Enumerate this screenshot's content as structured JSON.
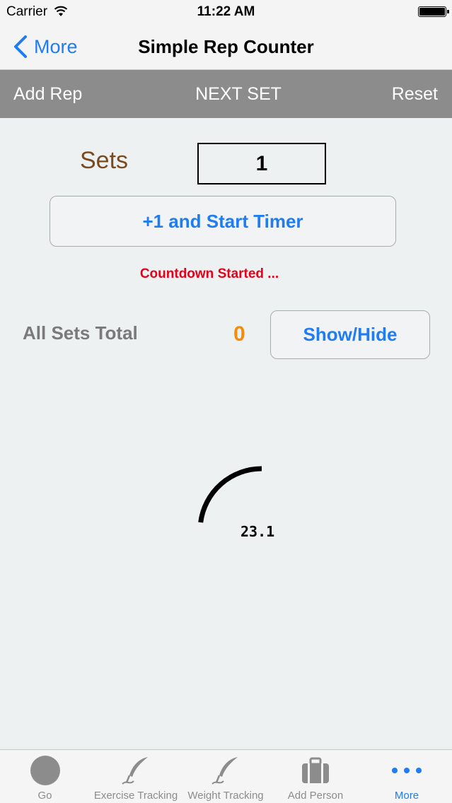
{
  "status_bar": {
    "carrier": "Carrier",
    "time": "11:22 AM"
  },
  "nav": {
    "back_label": "More",
    "title": "Simple Rep Counter"
  },
  "toolbar": {
    "add_rep": "Add Rep",
    "next_set": "NEXT SET",
    "reset": "Reset"
  },
  "sets": {
    "label": "Sets",
    "value": "1"
  },
  "start_timer_label": "+1 and Start Timer",
  "countdown_status": "Countdown Started ...",
  "totals": {
    "label": "All Sets Total",
    "value": "0",
    "toggle_label": "Show/Hide"
  },
  "timer": {
    "display": "23.1",
    "progress": 0.23
  },
  "tabs": [
    {
      "label": "Go",
      "icon": "circle-icon"
    },
    {
      "label": "Exercise Tracking",
      "icon": "quill-icon"
    },
    {
      "label": "Weight Tracking",
      "icon": "quill-icon"
    },
    {
      "label": "Add Person",
      "icon": "briefcase-icon"
    },
    {
      "label": "More",
      "icon": "more-dots-icon",
      "active": true
    }
  ],
  "colors": {
    "accent": "#1f7cf2",
    "sets_label": "#7b4a1c",
    "countdown": "#e6001a",
    "total_value": "#f28c0f",
    "toolbar_bg": "#8c8c8c"
  }
}
